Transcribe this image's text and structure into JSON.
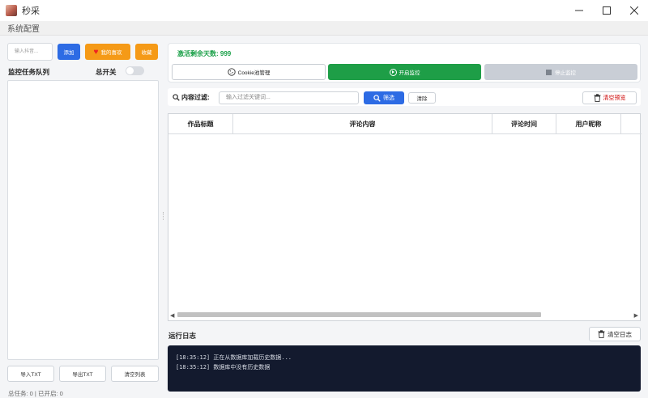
{
  "window": {
    "title": "秒采",
    "minimize_icon": "minimize-icon",
    "maximize_icon": "maximize-icon",
    "close_icon": "close-icon"
  },
  "menu": {
    "items": [
      "系统配置"
    ]
  },
  "left": {
    "uid_placeholder": "输入抖音...",
    "add_label": "添加",
    "favorites_label": "我的喜欢",
    "collect_label": "收藏",
    "queue_title": "监控任务队列",
    "master_switch_label": "总开关",
    "master_switch_on": false,
    "import_label": "导入TXT",
    "export_label": "导出TXT",
    "clear_list_label": "清空列表",
    "stats_text": "总任务: 0 | 已开启: 0"
  },
  "right": {
    "days_text": "激活剩余天数: 999",
    "cookie_label": "Cookie池管理",
    "start_label": "开启监控",
    "stop_label": "停止监控",
    "filter_label": "内容过滤:",
    "filter_placeholder": "输入过滤关键词...",
    "filter_button": "筛选",
    "clear_button": "清除",
    "clear_preview_button": "清空预览",
    "table_headers": [
      "作品标题",
      "评论内容",
      "评论时间",
      "用户昵称"
    ],
    "log_title": "运行日志",
    "clear_log_button": "清空日志",
    "log_lines": [
      "[18:35:12] 正在从数据库加载历史数据...",
      "[18:35:12] 数据库中没有历史数据"
    ]
  },
  "colors": {
    "primary_blue": "#2d6be4",
    "orange": "#f59a17",
    "green": "#1e9e47",
    "disabled_gray": "#c9ced6",
    "log_bg": "#131a2e",
    "danger_red": "#cc0000"
  }
}
